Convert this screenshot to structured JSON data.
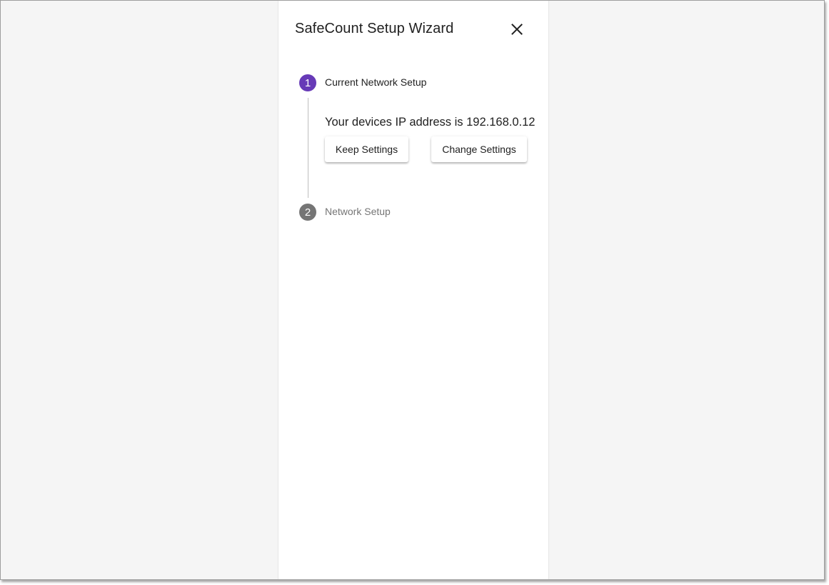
{
  "dialog": {
    "title": "SafeCount Setup Wizard",
    "close_icon": "close-icon"
  },
  "steps": [
    {
      "number": "1",
      "label": "Current Network Setup",
      "state": "active",
      "color": "#673ab7",
      "content": {
        "message": "Your devices IP address is 192.168.0.12",
        "buttons": [
          "Keep Settings",
          "Change Settings"
        ]
      }
    },
    {
      "number": "2",
      "label": "Network Setup",
      "state": "inactive",
      "color": "#757575"
    }
  ],
  "colors": {
    "accent": "#673ab7",
    "inactive": "#757575",
    "background": "#f5f5f5"
  }
}
